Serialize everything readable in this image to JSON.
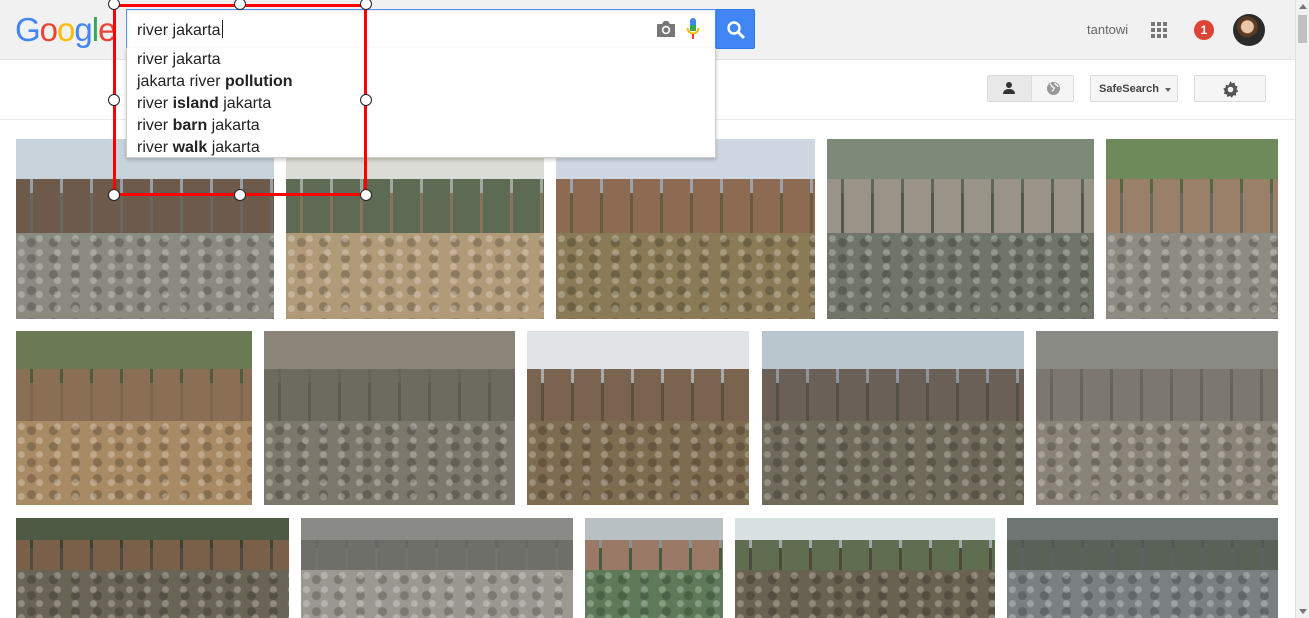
{
  "header": {
    "logo_text": "Google",
    "query": "river jakarta",
    "username": "tantowi",
    "notification_count": "1",
    "icons": [
      "camera-icon",
      "mic-icon",
      "search-icon",
      "apps-grid-icon",
      "avatar"
    ]
  },
  "suggestions": [
    {
      "plain_before": "river jakarta",
      "bold": "",
      "plain_after": ""
    },
    {
      "plain_before": "jakarta river ",
      "bold": "pollution",
      "plain_after": ""
    },
    {
      "plain_before": "river ",
      "bold": "island",
      "plain_after": " jakarta"
    },
    {
      "plain_before": "river ",
      "bold": "barn",
      "plain_after": " jakarta"
    },
    {
      "plain_before": "river ",
      "bold": "walk",
      "plain_after": " jakarta"
    }
  ],
  "toolbar": {
    "safesearch_label": "SafeSearch",
    "icons": [
      "person-icon",
      "globe-icon",
      "gear-icon"
    ]
  },
  "colors": {
    "accent": "#4285f4",
    "badge": "#db4437",
    "selection": "#ff0000"
  },
  "images": [
    {
      "name": "image-result-1",
      "sky": "#c9d3dc",
      "house": "#6e5a4a",
      "ground": "#8a8a80"
    },
    {
      "name": "image-result-2",
      "sky": "#dcdcd6",
      "house": "#5d6b55",
      "ground": "#b09a78"
    },
    {
      "name": "image-result-3",
      "sky": "#cfd8e2",
      "house": "#8d6b52",
      "ground": "#8a7a55"
    },
    {
      "name": "image-result-4",
      "sky": "#7d8a7a",
      "house": "#9a9488",
      "ground": "#6f7568"
    },
    {
      "name": "image-result-5",
      "sky": "#6f8a5a",
      "house": "#9a8068",
      "ground": "#8d8c82"
    },
    {
      "name": "image-result-6",
      "sky": "#6a7a52",
      "house": "#8a6f55",
      "ground": "#a88a64"
    },
    {
      "name": "image-result-7",
      "sky": "#8a8578",
      "house": "#6d6a60",
      "ground": "#7c786c"
    },
    {
      "name": "image-result-8",
      "sky": "#e0e4e6",
      "house": "#7a6450",
      "ground": "#7e6c50"
    },
    {
      "name": "image-result-9",
      "sky": "#b8c6ce",
      "house": "#6b6058",
      "ground": "#6f6a5a"
    },
    {
      "name": "image-result-10",
      "sky": "#8a8a84",
      "house": "#7c7870",
      "ground": "#8a8478"
    },
    {
      "name": "image-result-11",
      "sky": "#4f5a44",
      "house": "#7a6048",
      "ground": "#6a6456"
    },
    {
      "name": "image-result-12",
      "sky": "#8a8a86",
      "house": "#6f6f6a",
      "ground": "#9a9890"
    },
    {
      "name": "image-result-13",
      "sky": "#b8c0c4",
      "house": "#9a7a66",
      "ground": "#5e7a58"
    },
    {
      "name": "image-result-14",
      "sky": "#d8e0e2",
      "house": "#5f6e50",
      "ground": "#6a6250"
    },
    {
      "name": "image-result-15",
      "sky": "#6f7572",
      "house": "#5a6258",
      "ground": "#7a8080"
    }
  ]
}
